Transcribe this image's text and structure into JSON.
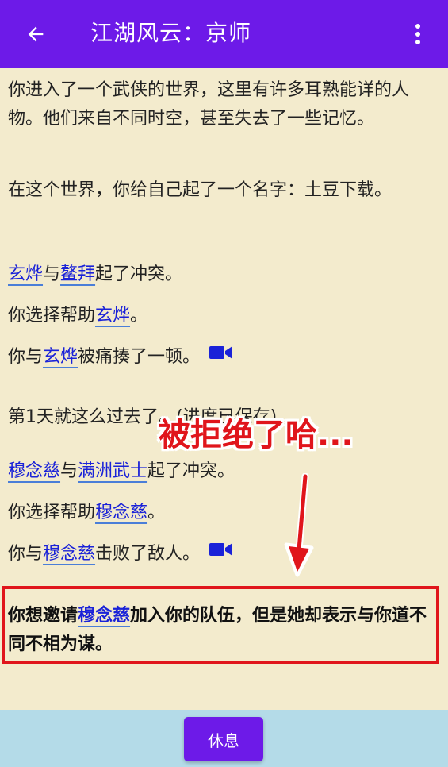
{
  "appbar": {
    "title": "江湖风云：京师",
    "back_icon": "arrow-left-icon",
    "more_icon": "more-vertical-icon"
  },
  "story": {
    "intro1": "你进入了一个武侠的世界，这里有许多耳熟能详的人物。他们来自不同时空，甚至失去了一些记忆。",
    "intro2": "在这个世界，你给自己起了一个名字：土豆下载。",
    "e1": {
      "a": "玄烨",
      "mid": "与",
      "b": "鳌拜",
      "tail": "起了冲突。"
    },
    "e2": {
      "pre": "你选择帮助",
      "a": "玄烨",
      "tail": "。"
    },
    "e3": {
      "pre": "你与",
      "a": "玄烨",
      "tail": "被痛揍了一顿。"
    },
    "day": "第1天就这么过去了。(进度已保存)",
    "e4": {
      "a": "穆念慈",
      "mid": "与",
      "b": "满洲武士",
      "tail": "起了冲突。"
    },
    "e5": {
      "pre": "你选择帮助",
      "a": "穆念慈",
      "tail": "。"
    },
    "e6": {
      "pre": "你与",
      "a": "穆念慈",
      "tail": "击败了敌人。"
    },
    "invite": {
      "pre": "你想邀请",
      "a": "穆念慈",
      "tail": "加入你的队伍，但是她却表示与你道不同不相为谋。"
    }
  },
  "annotation": {
    "text": "被拒绝了哈..."
  },
  "bottom": {
    "rest_label": "休息"
  },
  "colors": {
    "appbar": "#6d1ae8",
    "background": "#f3ebcd",
    "link": "#1a22d8",
    "annotation": "#e0151b",
    "bottom_bar": "#b4dbe8",
    "video_icon": "#1a22d8"
  },
  "icons": {
    "video": "video-camera-icon"
  }
}
